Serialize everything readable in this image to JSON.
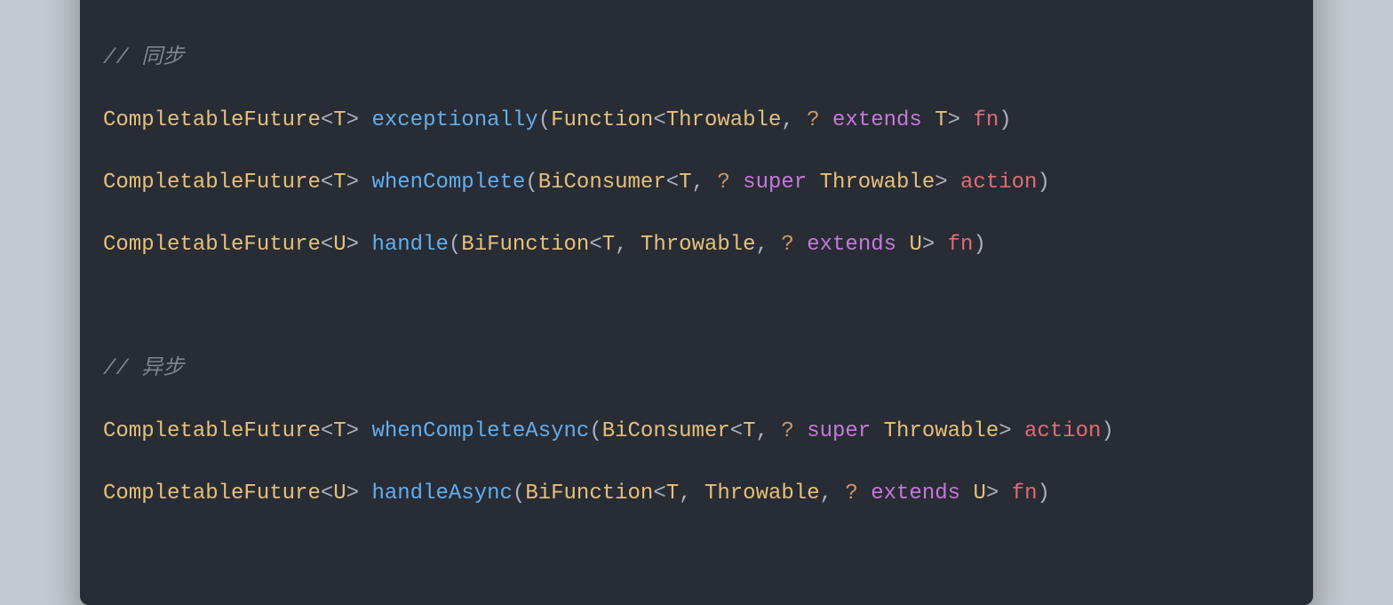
{
  "window": {
    "traffic": {
      "red": "#ff5f56",
      "yellow": "#ffbd2e",
      "green": "#27c93f"
    }
  },
  "code": {
    "comment_sync": "// 同步",
    "comment_async": "// 异步",
    "cf": "CompletableFuture",
    "lt": "<",
    "gt": ">",
    "T": "T",
    "U": "U",
    "lparen": "(",
    "rparen": ")",
    "comma": ",",
    "qmark": "?",
    "extends": "extends",
    "super": "super",
    "space": " ",
    "m_exceptionally": "exceptionally",
    "m_whenComplete": "whenComplete",
    "m_handle": "handle",
    "m_whenCompleteAsync": "whenCompleteAsync",
    "m_handleAsync": "handleAsync",
    "t_Function": "Function",
    "t_BiConsumer": "BiConsumer",
    "t_BiFunction": "BiFunction",
    "t_Throwable": "Throwable",
    "p_fn": "fn",
    "p_action": "action"
  }
}
